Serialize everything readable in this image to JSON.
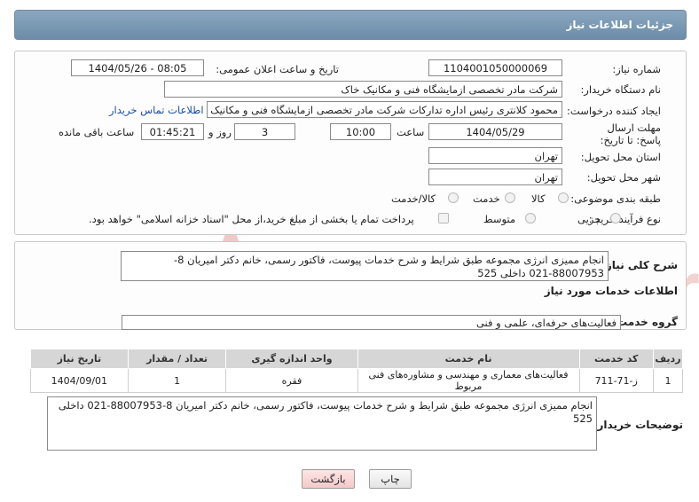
{
  "header": {
    "title": "جزئیات اطلاعات نیاز"
  },
  "fields": {
    "need_number_label": "شماره نیاز:",
    "need_number": "1104001050000069",
    "announce_label": "تاریخ و ساعت اعلان عمومی:",
    "announce_value": "1404/05/26 - 08:05",
    "buyer_label": "نام دستگاه خریدار:",
    "buyer_value": "شرکت مادر تخصصی ازمایشگاه فنی و مکانیک خاک",
    "creator_label": "ایجاد کننده درخواست:",
    "creator_value": "محمود کلانتری رئیس اداره تدارکات شرکت مادر تخصصی ازمایشگاه فنی و مکانیک خاک",
    "contact_link": "اطلاعات تماس خریدار",
    "deadline_label": "مهلت ارسال پاسخ: تا تاریخ:",
    "deadline_date": "1404/05/29",
    "time_label": "ساعت",
    "deadline_time": "10:00",
    "days_value": "3",
    "days_label": "روز و",
    "remaining_time": "01:45:21",
    "remaining_label": "ساعت باقی مانده",
    "province_label": "استان محل تحویل:",
    "province_value": "تهران",
    "city_label": "شهر محل تحویل:",
    "city_value": "تهران",
    "category_label": "طبقه بندی موضوعی:",
    "category_options": [
      "کالا",
      "خدمت",
      "کالا/خدمت"
    ],
    "category_selected": "خدمت",
    "process_label": "نوع فرآیند خرید :",
    "process_options": [
      "جزیی",
      "متوسط"
    ],
    "process_selected": "جزیی",
    "payment_note": "پرداخت تمام یا بخشی از مبلغ خرید،از محل \"اسناد خزانه اسلامی\" خواهد بود."
  },
  "description": {
    "label": "شرح کلی نیاز:",
    "text": "انجام مميزی انرژی مجموعه طبق شرایط و شرح خدمات پیوست، فاکتور رسمی، خانم دکتر امیریان  8-88007953-021 داخلی 525"
  },
  "services": {
    "section_title": "اطلاعات خدمات مورد نیاز",
    "group_label": "گروه خدمت:",
    "group_value": "فعالیت‌های حرفه‌ای، علمی و فنی",
    "columns": [
      "ردیف",
      "کد خدمت",
      "نام خدمت",
      "واحد اندازه گیری",
      "تعداد / مقدار",
      "تاریخ نیاز"
    ],
    "rows": [
      [
        "1",
        "ز-71-711",
        "فعالیت‌های معماری و مهندسی و مشاوره‌های فنی مربوط",
        "فقره",
        "1",
        "1404/09/01"
      ]
    ]
  },
  "buyer_notes": {
    "label": "توضیحات خریدار:",
    "text": "انجام مميزی انرژی مجموعه طبق شرایط و شرح خدمات پیوست، فاکتور رسمی، خانم دکتر امیریان  8-88007953-021 داخلی 525"
  },
  "buttons": {
    "print": "چاپ",
    "back": "بازگشت"
  },
  "watermark": {
    "text": "AriaTender.neT"
  },
  "colors": {
    "header": "#7592ad",
    "link": "#1a4fa0",
    "back_button_bg": "#f9d6d6",
    "watermark": "#e9b3b3"
  }
}
